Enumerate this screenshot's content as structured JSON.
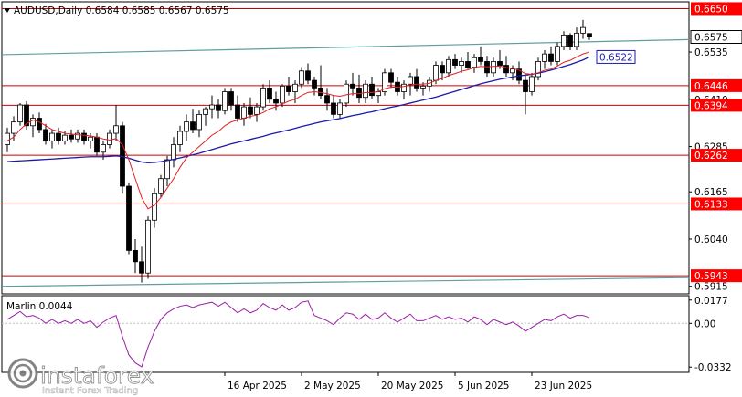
{
  "app": {
    "header_text": "AUDUSD,Daily  0.6584 0.6585 0.6567 0.6575",
    "watermark_brand": "instaforex",
    "watermark_tagline": "Instant Forex Trading",
    "colors": {
      "background": "#ffffff",
      "bull_candle": "#ffffff",
      "bear_candle": "#000000",
      "wick": "#000000",
      "level_line": "#cc0000",
      "channel_line": "#5f9ea0",
      "ma_fast": "#e02020",
      "ma_slow": "#1a1aa8",
      "marlin_line": "#9c1fa8",
      "price_tag_bg": "#ff0000",
      "current_price_bg": "#ffffff",
      "ma_tag_border": "#1a1ab8"
    }
  },
  "chart_data": {
    "type": "candlestick",
    "symbol": "AUDUSD",
    "timeframe": "Daily",
    "header_ohlc": {
      "open": 0.6584,
      "high": 0.6585,
      "low": 0.6567,
      "close": 0.6575
    },
    "price_axis_ticks": [
      "0.6535",
      "0.6410",
      "0.6285",
      "0.6165",
      "0.6040",
      "0.5915"
    ],
    "x_tick_labels": [
      "16 Apr 2025",
      "2 May 2025",
      "20 May 2025",
      "5 Jun 2025",
      "23 Jun 2025"
    ],
    "x_tick_indices": [
      34,
      46,
      58,
      70,
      82
    ],
    "price_range": [
      0.5895,
      0.6668
    ],
    "levels": [
      {
        "label": "0.6650",
        "value": 0.665
      },
      {
        "label": "0.6446",
        "value": 0.6446
      },
      {
        "label": "0.6394",
        "value": 0.6394
      },
      {
        "label": "0.6262",
        "value": 0.6262
      },
      {
        "label": "0.6133",
        "value": 0.6133
      },
      {
        "label": "0.5943",
        "value": 0.5943
      }
    ],
    "current_price": {
      "label": "0.6575",
      "value": 0.6575
    },
    "ma_tag": {
      "label": "0.6522",
      "value": 0.6522
    },
    "channel_upper": {
      "start_value": 0.6528,
      "end_value": 0.6568
    },
    "channel_lower": {
      "start_value": 0.5915,
      "end_value": 0.5938
    },
    "candles": [
      [
        0.629,
        0.6335,
        0.627,
        0.632
      ],
      [
        0.632,
        0.6365,
        0.63,
        0.635
      ],
      [
        0.635,
        0.64,
        0.634,
        0.6395
      ],
      [
        0.6395,
        0.6405,
        0.633,
        0.634
      ],
      [
        0.634,
        0.637,
        0.631,
        0.636
      ],
      [
        0.636,
        0.6375,
        0.632,
        0.633
      ],
      [
        0.633,
        0.6345,
        0.629,
        0.63
      ],
      [
        0.63,
        0.633,
        0.628,
        0.632
      ],
      [
        0.632,
        0.6335,
        0.629,
        0.63
      ],
      [
        0.63,
        0.6325,
        0.629,
        0.6315
      ],
      [
        0.6315,
        0.633,
        0.6295,
        0.6305
      ],
      [
        0.6305,
        0.633,
        0.6295,
        0.632
      ],
      [
        0.632,
        0.633,
        0.629,
        0.63
      ],
      [
        0.63,
        0.632,
        0.628,
        0.631
      ],
      [
        0.631,
        0.632,
        0.626,
        0.627
      ],
      [
        0.627,
        0.63,
        0.625,
        0.629
      ],
      [
        0.629,
        0.633,
        0.628,
        0.632
      ],
      [
        0.632,
        0.6395,
        0.63,
        0.634
      ],
      [
        0.634,
        0.635,
        0.616,
        0.618
      ],
      [
        0.618,
        0.619,
        0.6,
        0.601
      ],
      [
        0.601,
        0.604,
        0.595,
        0.598
      ],
      [
        0.598,
        0.602,
        0.5925,
        0.595
      ],
      [
        0.595,
        0.61,
        0.5935,
        0.609
      ],
      [
        0.609,
        0.6175,
        0.607,
        0.616
      ],
      [
        0.616,
        0.621,
        0.615,
        0.62
      ],
      [
        0.62,
        0.626,
        0.618,
        0.625
      ],
      [
        0.625,
        0.631,
        0.623,
        0.629
      ],
      [
        0.629,
        0.634,
        0.627,
        0.6325
      ],
      [
        0.6325,
        0.637,
        0.63,
        0.635
      ],
      [
        0.635,
        0.6385,
        0.632,
        0.633
      ],
      [
        0.633,
        0.638,
        0.631,
        0.637
      ],
      [
        0.637,
        0.639,
        0.634,
        0.6385
      ],
      [
        0.6385,
        0.642,
        0.636,
        0.6395
      ],
      [
        0.6395,
        0.641,
        0.636,
        0.638
      ],
      [
        0.638,
        0.644,
        0.637,
        0.643
      ],
      [
        0.643,
        0.644,
        0.638,
        0.6395
      ],
      [
        0.6395,
        0.642,
        0.635,
        0.636
      ],
      [
        0.636,
        0.64,
        0.634,
        0.639
      ],
      [
        0.639,
        0.6415,
        0.636,
        0.637
      ],
      [
        0.637,
        0.64,
        0.635,
        0.639
      ],
      [
        0.639,
        0.645,
        0.638,
        0.644
      ],
      [
        0.644,
        0.646,
        0.64,
        0.641
      ],
      [
        0.641,
        0.643,
        0.638,
        0.64
      ],
      [
        0.64,
        0.645,
        0.639,
        0.6445
      ],
      [
        0.6445,
        0.647,
        0.642,
        0.643
      ],
      [
        0.643,
        0.646,
        0.64,
        0.645
      ],
      [
        0.645,
        0.6495,
        0.644,
        0.6485
      ],
      [
        0.6485,
        0.6505,
        0.645,
        0.646
      ],
      [
        0.646,
        0.647,
        0.642,
        0.644
      ],
      [
        0.644,
        0.65,
        0.641,
        0.642
      ],
      [
        0.642,
        0.644,
        0.638,
        0.64
      ],
      [
        0.64,
        0.642,
        0.636,
        0.637
      ],
      [
        0.637,
        0.641,
        0.636,
        0.64
      ],
      [
        0.64,
        0.646,
        0.639,
        0.645
      ],
      [
        0.645,
        0.648,
        0.642,
        0.644
      ],
      [
        0.644,
        0.6475,
        0.64,
        0.6415
      ],
      [
        0.6415,
        0.646,
        0.64,
        0.645
      ],
      [
        0.645,
        0.647,
        0.641,
        0.642
      ],
      [
        0.642,
        0.644,
        0.64,
        0.643
      ],
      [
        0.643,
        0.649,
        0.642,
        0.648
      ],
      [
        0.648,
        0.649,
        0.644,
        0.6455
      ],
      [
        0.6455,
        0.647,
        0.642,
        0.643
      ],
      [
        0.643,
        0.646,
        0.641,
        0.645
      ],
      [
        0.645,
        0.648,
        0.642,
        0.647
      ],
      [
        0.647,
        0.649,
        0.643,
        0.644
      ],
      [
        0.644,
        0.6455,
        0.642,
        0.6445
      ],
      [
        0.6445,
        0.647,
        0.643,
        0.646
      ],
      [
        0.646,
        0.651,
        0.645,
        0.65
      ],
      [
        0.65,
        0.651,
        0.646,
        0.648
      ],
      [
        0.648,
        0.6525,
        0.647,
        0.6515
      ],
      [
        0.6515,
        0.653,
        0.649,
        0.65
      ],
      [
        0.65,
        0.652,
        0.648,
        0.651
      ],
      [
        0.651,
        0.6535,
        0.649,
        0.6495
      ],
      [
        0.6495,
        0.653,
        0.648,
        0.652
      ],
      [
        0.652,
        0.655,
        0.65,
        0.651
      ],
      [
        0.651,
        0.6525,
        0.647,
        0.648
      ],
      [
        0.648,
        0.652,
        0.647,
        0.651
      ],
      [
        0.651,
        0.654,
        0.649,
        0.65
      ],
      [
        0.65,
        0.6525,
        0.647,
        0.648
      ],
      [
        0.648,
        0.65,
        0.646,
        0.649
      ],
      [
        0.649,
        0.651,
        0.645,
        0.646
      ],
      [
        0.646,
        0.6475,
        0.637,
        0.643
      ],
      [
        0.643,
        0.648,
        0.642,
        0.647
      ],
      [
        0.647,
        0.652,
        0.646,
        0.651
      ],
      [
        0.651,
        0.654,
        0.649,
        0.653
      ],
      [
        0.653,
        0.655,
        0.65,
        0.651
      ],
      [
        0.651,
        0.656,
        0.65,
        0.655
      ],
      [
        0.655,
        0.659,
        0.654,
        0.658
      ],
      [
        0.658,
        0.6585,
        0.654,
        0.655
      ],
      [
        0.655,
        0.66,
        0.654,
        0.6585
      ],
      [
        0.6585,
        0.662,
        0.657,
        0.66
      ],
      [
        0.6584,
        0.6585,
        0.6567,
        0.6575
      ]
    ],
    "ma_fast": [
      0.63,
      0.631,
      0.633,
      0.6345,
      0.6355,
      0.635,
      0.634,
      0.633,
      0.6325,
      0.632,
      0.6318,
      0.6316,
      0.6315,
      0.6313,
      0.631,
      0.6305,
      0.6302,
      0.6306,
      0.629,
      0.625,
      0.62,
      0.615,
      0.612,
      0.613,
      0.615,
      0.6175,
      0.62,
      0.623,
      0.6255,
      0.627,
      0.6285,
      0.63,
      0.6315,
      0.6325,
      0.634,
      0.635,
      0.6355,
      0.636,
      0.6365,
      0.6368,
      0.6375,
      0.6385,
      0.639,
      0.6398,
      0.6405,
      0.641,
      0.642,
      0.6428,
      0.643,
      0.6428,
      0.6425,
      0.642,
      0.6418,
      0.6422,
      0.6425,
      0.6425,
      0.6428,
      0.6428,
      0.643,
      0.6438,
      0.6442,
      0.6442,
      0.6444,
      0.6448,
      0.645,
      0.645,
      0.6452,
      0.646,
      0.6465,
      0.6473,
      0.6478,
      0.6484,
      0.6488,
      0.6494,
      0.6497,
      0.6496,
      0.6497,
      0.6498,
      0.6494,
      0.6492,
      0.6487,
      0.6478,
      0.6476,
      0.648,
      0.6487,
      0.649,
      0.6498,
      0.6508,
      0.6513,
      0.6522,
      0.653,
      0.6535
    ],
    "ma_slow": [
      0.6245,
      0.6246,
      0.6247,
      0.6248,
      0.6249,
      0.625,
      0.6251,
      0.6252,
      0.6253,
      0.6254,
      0.6255,
      0.6256,
      0.6257,
      0.6258,
      0.6258,
      0.6258,
      0.6259,
      0.626,
      0.6258,
      0.6254,
      0.6249,
      0.6244,
      0.6242,
      0.6243,
      0.6245,
      0.6248,
      0.6251,
      0.6255,
      0.6259,
      0.6263,
      0.6267,
      0.6272,
      0.6277,
      0.6282,
      0.6287,
      0.6292,
      0.6296,
      0.63,
      0.6304,
      0.6308,
      0.6312,
      0.6317,
      0.6321,
      0.6325,
      0.6329,
      0.6333,
      0.6338,
      0.6342,
      0.6346,
      0.635,
      0.6353,
      0.6356,
      0.6359,
      0.6363,
      0.6367,
      0.637,
      0.6374,
      0.6377,
      0.6381,
      0.6385,
      0.6389,
      0.6392,
      0.6396,
      0.64,
      0.6404,
      0.6408,
      0.6412,
      0.6416,
      0.6421,
      0.6426,
      0.6431,
      0.6436,
      0.6441,
      0.6446,
      0.6451,
      0.6455,
      0.6459,
      0.6463,
      0.6466,
      0.6469,
      0.6472,
      0.6474,
      0.6476,
      0.6479,
      0.6483,
      0.6487,
      0.6492,
      0.6497,
      0.6502,
      0.6508,
      0.6514,
      0.6522
    ],
    "oscillator": {
      "name": "Marlin",
      "value_label": "0.0044",
      "ticks": [
        "0.0177",
        "0.00",
        "-0.0332"
      ],
      "range": [
        -0.0372,
        0.021
      ],
      "values": [
        0.003,
        0.006,
        0.009,
        0.005,
        0.006,
        0.004,
        0.0,
        0.003,
        0.0,
        0.002,
        0.0,
        0.003,
        0.0,
        0.002,
        -0.003,
        0.001,
        0.004,
        0.006,
        -0.01,
        -0.024,
        -0.03,
        -0.033,
        -0.018,
        -0.006,
        0.003,
        0.008,
        0.011,
        0.013,
        0.014,
        0.012,
        0.014,
        0.015,
        0.016,
        0.013,
        0.016,
        0.012,
        0.008,
        0.011,
        0.008,
        0.01,
        0.015,
        0.012,
        0.01,
        0.014,
        0.01,
        0.012,
        0.016,
        0.017,
        0.006,
        0.004,
        0.002,
        -0.001,
        0.004,
        0.008,
        0.007,
        0.003,
        0.007,
        0.003,
        0.004,
        0.008,
        0.004,
        0.001,
        0.004,
        0.007,
        0.002,
        0.002,
        0.004,
        0.006,
        0.003,
        0.005,
        0.003,
        0.004,
        0.001,
        0.005,
        0.003,
        -0.001,
        0.003,
        0.001,
        -0.001,
        0.001,
        -0.002,
        -0.006,
        -0.003,
        0.0,
        0.003,
        0.002,
        0.005,
        0.007,
        0.004,
        0.006,
        0.006,
        0.0044
      ]
    }
  }
}
